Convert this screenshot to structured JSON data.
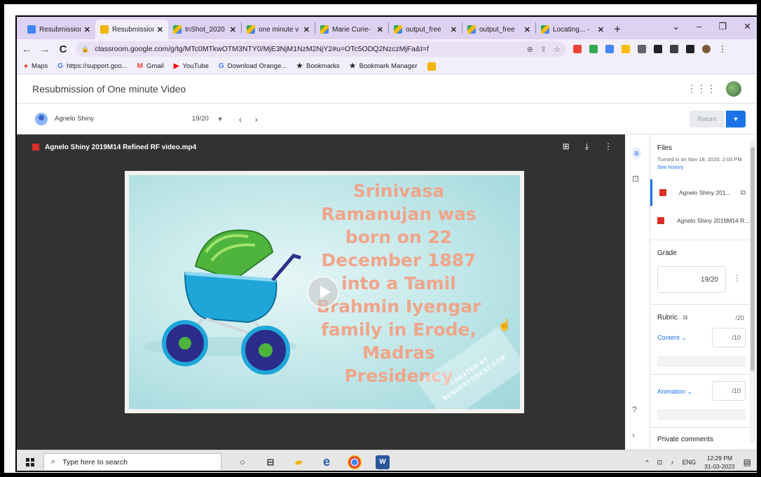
{
  "browser": {
    "tabs": [
      {
        "label": "Resubmission",
        "color": "#4285f4",
        "active": false
      },
      {
        "label": "Resubmission",
        "color": "#f4b400",
        "active": true
      },
      {
        "label": "InShot_2020",
        "color": "#34a853",
        "active": false
      },
      {
        "label": "one minute v",
        "color": "#34a853",
        "active": false
      },
      {
        "label": "Marie Curie-",
        "color": "#34a853",
        "active": false
      },
      {
        "label": "output_free",
        "color": "#34a853",
        "active": false
      },
      {
        "label": "output_free",
        "color": "#34a853",
        "active": false
      },
      {
        "label": "Locating... -",
        "color": "#34a853",
        "active": false
      }
    ],
    "new_tab": "+",
    "window_controls": [
      "⌄",
      "–",
      "❐",
      "✕"
    ],
    "url": "classroom.google.com/g/tg/MTc0MTkwOTM3NTY0/MjE3NjM1NzM2NjY2#u=OTc5ODQ2NzczMjFa&t=f",
    "bookmarks": [
      {
        "label": "Maps",
        "icon": "maps-pin-icon"
      },
      {
        "label": "https://support.goo...",
        "icon": "google-icon"
      },
      {
        "label": "Gmail",
        "icon": "gmail-icon"
      },
      {
        "label": "YouTube",
        "icon": "youtube-icon"
      },
      {
        "label": "Download Orange...",
        "icon": "google-icon"
      },
      {
        "label": "Bookmarks",
        "icon": "star-icon"
      },
      {
        "label": "Bookmark Manager",
        "icon": "star-icon"
      }
    ]
  },
  "classroom": {
    "title": "Resubmission of One minute Video",
    "student_name": "Agnelo Shiny",
    "grade": "19/20",
    "return_label": "Return"
  },
  "viewer": {
    "file_name": "Agnelo Shiny 2019M14 Refined RF video.mp4",
    "video_text": [
      "Srinivasa",
      "Ramanujan was",
      "born on 22",
      "December 1887",
      "into a Tamil",
      "Brahmin Iyengar",
      "family in Erode,",
      "Madras",
      "Presidency"
    ],
    "watermark": "CREATED BY RENDERFOREST.COM"
  },
  "panel": {
    "files_title": "Files",
    "turned_in": "Turned in on Nov 18, 2020, 2:03 PM",
    "see_history": "See history",
    "files": [
      "Agnelo Shiny 201...",
      "Agnelo Shiny 2019M14 R..."
    ],
    "grade_title": "Grade",
    "grade_value": "19/20",
    "rubric_title": "Rubric",
    "rubric_total": "/20",
    "criteria": [
      {
        "label": "Content",
        "max": "/10"
      },
      {
        "label": "Animation",
        "max": "/10"
      }
    ],
    "private_comments": "Private comments"
  },
  "taskbar": {
    "search_placeholder": "Type here to search",
    "lang": "ENG",
    "time": "12:29 PM",
    "date": "31-03-2023"
  }
}
